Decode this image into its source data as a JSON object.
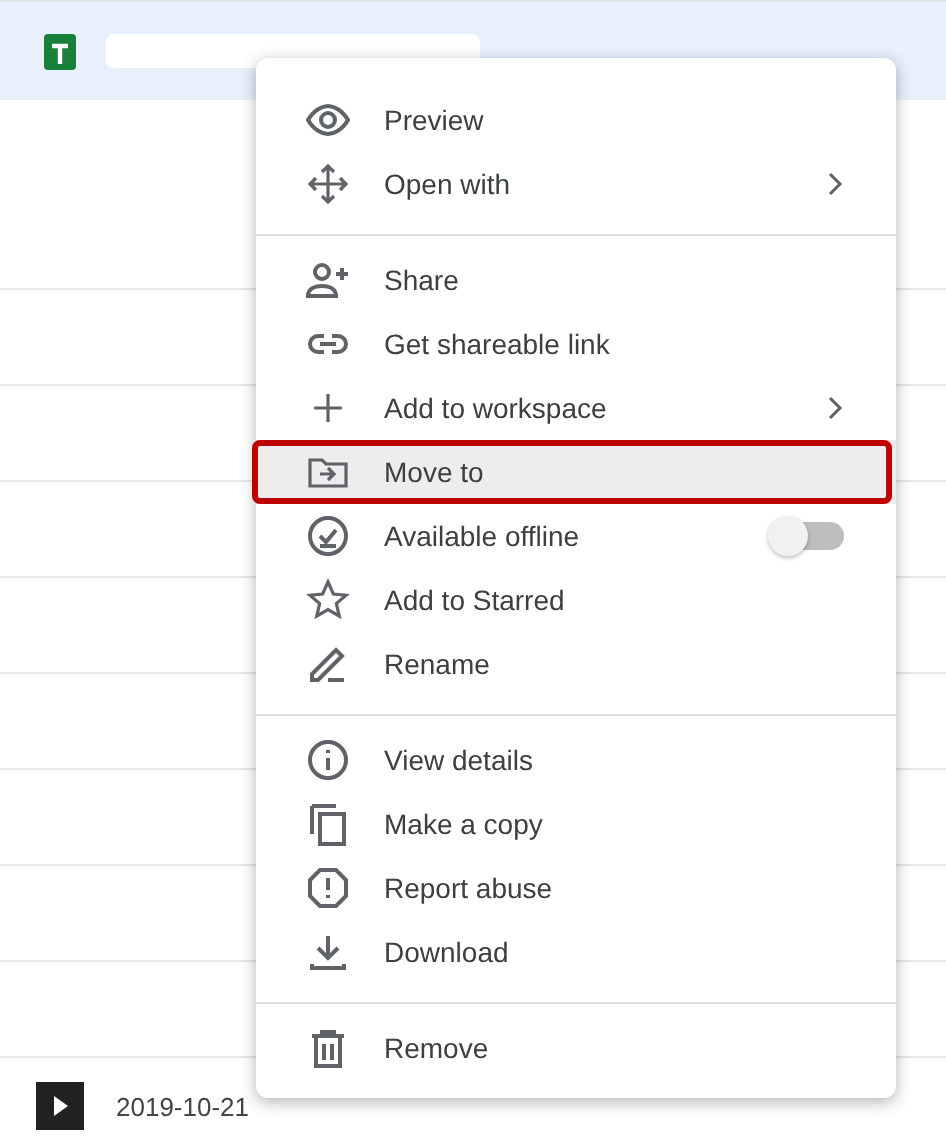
{
  "file_row": {
    "date": "2019-10-21"
  },
  "context_menu": {
    "sections": [
      {
        "items": [
          {
            "label": "Preview",
            "kind": "action",
            "selected": false
          },
          {
            "label": "Open with",
            "kind": "submenu",
            "selected": false
          }
        ]
      },
      {
        "items": [
          {
            "label": "Share",
            "kind": "action",
            "selected": false
          },
          {
            "label": "Get shareable link",
            "kind": "action",
            "selected": false
          },
          {
            "label": "Add to workspace",
            "kind": "submenu",
            "selected": false
          },
          {
            "label": "Move to",
            "kind": "action",
            "selected": true
          },
          {
            "label": "Available offline",
            "kind": "toggle",
            "on": false,
            "selected": false
          },
          {
            "label": "Add to Starred",
            "kind": "action",
            "selected": false
          },
          {
            "label": "Rename",
            "kind": "action",
            "selected": false
          }
        ]
      },
      {
        "items": [
          {
            "label": "View details",
            "kind": "action",
            "selected": false
          },
          {
            "label": "Make a copy",
            "kind": "action",
            "selected": false
          },
          {
            "label": "Report abuse",
            "kind": "action",
            "selected": false
          },
          {
            "label": "Download",
            "kind": "action",
            "selected": false
          }
        ]
      },
      {
        "items": [
          {
            "label": "Remove",
            "kind": "action",
            "selected": false
          }
        ]
      }
    ]
  }
}
